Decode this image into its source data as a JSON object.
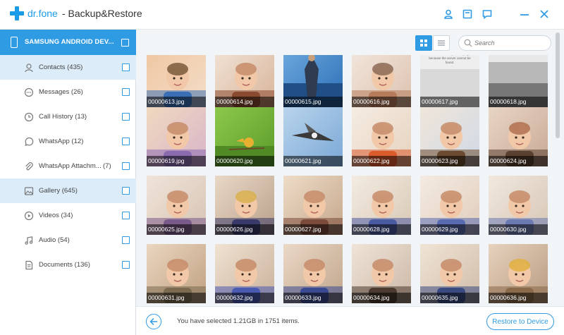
{
  "app": {
    "logo_text": "dr.fone",
    "title": "- Backup&Restore",
    "accent_color": "#2f9be3",
    "icons": [
      "user-icon",
      "save-icon",
      "feedback-icon",
      "minimize-icon",
      "close-icon"
    ]
  },
  "sidebar": {
    "device_name": "SAMSUNG ANDROID DEV...",
    "items": [
      {
        "label": "Contacts (435)",
        "count": "",
        "icon": "contact-icon",
        "active": true
      },
      {
        "label": "Messages (26)",
        "count": "",
        "icon": "message-icon",
        "active": false
      },
      {
        "label": "Call History (13)",
        "count": "",
        "icon": "clock-icon",
        "active": false
      },
      {
        "label": "WhatsApp (12)",
        "count": "",
        "icon": "whatsapp-icon",
        "active": false
      },
      {
        "label": "WhatsApp Attachm...",
        "count": "(7)",
        "icon": "attachment-icon",
        "active": false
      },
      {
        "label": "Gallery (645)",
        "count": "",
        "icon": "image-icon",
        "active": true
      },
      {
        "label": "Videos (34)",
        "count": "",
        "icon": "video-icon",
        "active": false
      },
      {
        "label": "Audio (54)",
        "count": "",
        "icon": "music-icon",
        "active": false
      },
      {
        "label": "Documents (136)",
        "count": "",
        "icon": "document-icon",
        "active": false
      }
    ]
  },
  "toolbar": {
    "search_placeholder": "Search"
  },
  "photos": [
    "00000613.jpg",
    "00000614.jpg",
    "00000615.jpg",
    "00000616.jpg",
    "00000617.jpg",
    "00000618.jpg",
    "00000619.jpg",
    "00000620.jpg",
    "00000621.jpg",
    "00000622.jpg",
    "00000623.jpg",
    "00000624.jpg",
    "00000625.jpg",
    "00000626.jpg",
    "00000627.jpg",
    "00000628.jpg",
    "00000629.jpg",
    "00000630.jpg",
    "00000631.jpg",
    "00000632.jpg",
    "00000633.jpg",
    "00000634.jpg",
    "00000635.jpg",
    "00000636.jpg"
  ],
  "photo_617_text": "Select subtext open the page because the server cannot be found.",
  "footer": {
    "status": "You have selected 1.21GB in 1751 items.",
    "restore_label": "Restore to Device"
  }
}
